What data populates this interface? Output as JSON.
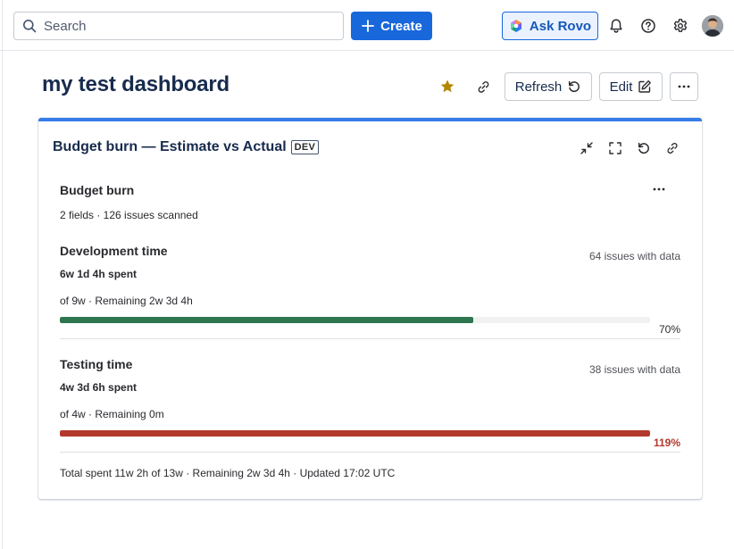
{
  "topbar": {
    "search_placeholder": "Search",
    "create_label": "Create",
    "ask_rovo_label": "Ask Rovo"
  },
  "header": {
    "title": "my test dashboard",
    "refresh_label": "Refresh",
    "edit_label": "Edit"
  },
  "gadget": {
    "title": "Budget burn — Estimate vs Actual",
    "badge": "DEV",
    "accent_color": "#357de8",
    "inner_title": "Budget burn",
    "summary": "2 fields · 126 issues scanned",
    "sections": [
      {
        "title": "Development time",
        "spent": "6w 1d 4h spent",
        "detail": "of 9w · Remaining 2w 3d 4h",
        "issues": "64 issues with data",
        "percent_label": "70%",
        "percent_value": 70,
        "bar_color": "#2e7650",
        "label_color": "#292a2e"
      },
      {
        "title": "Testing time",
        "spent": "4w 3d 6h spent",
        "detail": "of 4w · Remaining 0m",
        "issues": "38 issues with data",
        "percent_label": "119%",
        "percent_value": 119,
        "bar_color": "#b3392d",
        "label_color": "#b3392d"
      }
    ],
    "footer": "Total spent 11w 2h of 13w · Remaining 2w 3d 4h · Updated 17:02 UTC"
  }
}
